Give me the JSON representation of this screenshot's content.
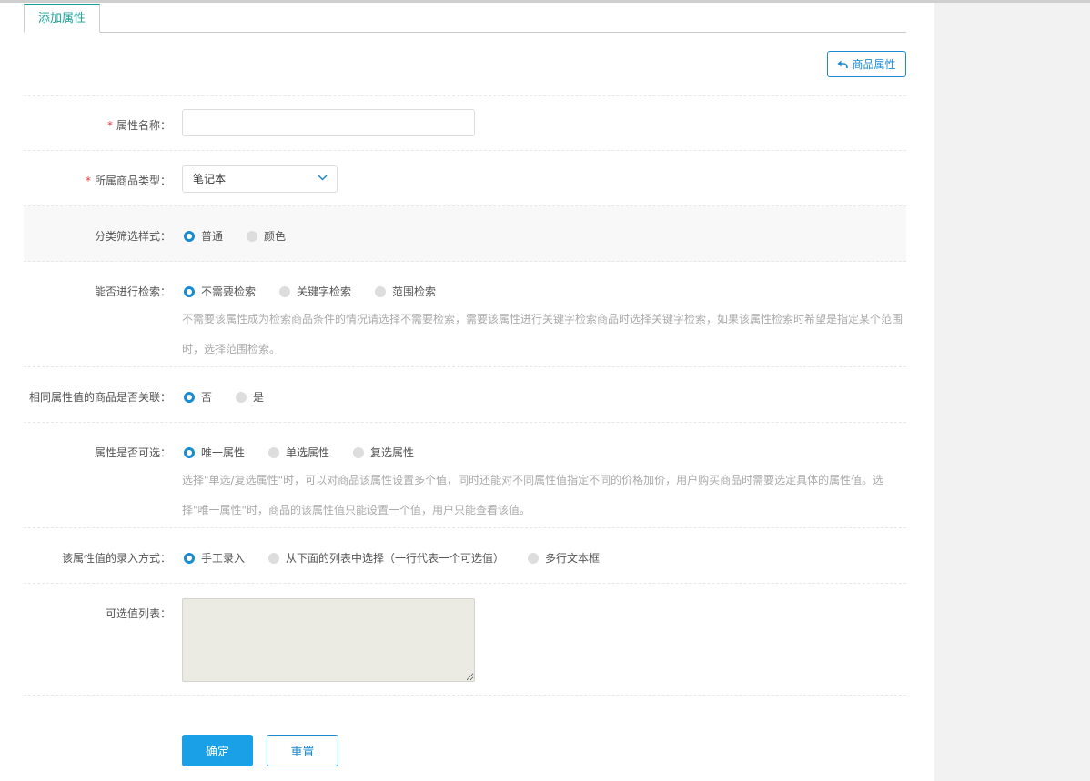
{
  "tab": {
    "label": "添加属性"
  },
  "back_button": {
    "label": "商品属性"
  },
  "form": {
    "required_mark": "*",
    "name": {
      "label": "属性名称：",
      "value": ""
    },
    "type": {
      "label": "所属商品类型：",
      "selected": "笔记本"
    },
    "filter_style": {
      "label": "分类筛选样式：",
      "options": [
        "普通",
        "颜色"
      ],
      "selected_index": 0
    },
    "search": {
      "label": "能否进行检索：",
      "options": [
        "不需要检索",
        "关键字检索",
        "范围检索"
      ],
      "selected_index": 0,
      "hint_line1": "不需要该属性成为检索商品条件的情况请选择不需要检索，需要该属性进行关键字检索商品时选择关键字检索，如果该属性检索时希望是指定某个范围",
      "hint_line2": "时，选择范围检索。"
    },
    "linked": {
      "label": "相同属性值的商品是否关联：",
      "options": [
        "否",
        "是"
      ],
      "selected_index": 0
    },
    "selectable": {
      "label": "属性是否可选：",
      "options": [
        "唯一属性",
        "单选属性",
        "复选属性"
      ],
      "selected_index": 0,
      "hint_line1": "选择\"单选/复选属性\"时，可以对商品该属性设置多个值，同时还能对不同属性值指定不同的价格加价，用户购买商品时需要选定具体的属性值。选",
      "hint_line2": "择\"唯一属性\"时，商品的该属性值只能设置一个值，用户只能查看该值。"
    },
    "input_mode": {
      "label": "该属性值的录入方式：",
      "options": [
        "手工录入",
        "从下面的列表中选择（一行代表一个可选值）",
        "多行文本框"
      ],
      "selected_index": 0
    },
    "values_list": {
      "label": "可选值列表：",
      "value": ""
    }
  },
  "actions": {
    "confirm": "确定",
    "reset": "重置"
  },
  "colors": {
    "accent_green": "#1aa094",
    "accent_blue": "#1a8bd1",
    "required_red": "#e4393c"
  }
}
